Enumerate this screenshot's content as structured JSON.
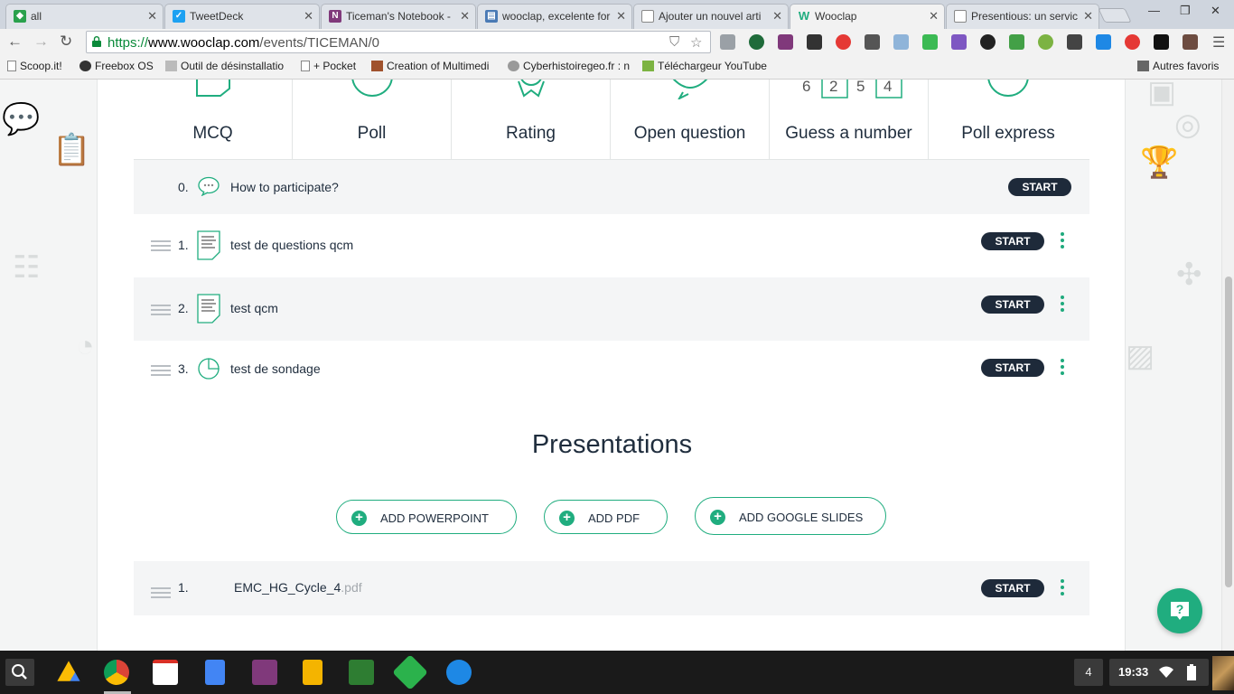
{
  "browser": {
    "tabs": [
      {
        "title": "all",
        "favicon_color": "#2aa14d",
        "close": "✕"
      },
      {
        "title": "TweetDeck",
        "favicon_color": "#1da1f2",
        "close": "✕"
      },
      {
        "title": "Ticeman's Notebook -",
        "favicon_color": "#80397b",
        "close": "✕"
      },
      {
        "title": "wooclap, excelente for",
        "favicon_color": "#4a7ab5",
        "close": "✕"
      },
      {
        "title": "Ajouter un nouvel arti",
        "favicon_color": "#8a8a8a",
        "close": "✕"
      },
      {
        "title": "Wooclap",
        "favicon_color": "#20ad7f",
        "favicon_text": "W",
        "close": "✕",
        "active": true
      },
      {
        "title": "Presentious: un servic",
        "favicon_color": "#8a8a8a",
        "close": "✕"
      }
    ],
    "url": {
      "scheme": "https://",
      "domain": "www.wooclap.com",
      "path": "/events/TICEMAN/0"
    },
    "bookmarks": [
      {
        "label": "Scoop.it!"
      },
      {
        "label": "Freebox OS"
      },
      {
        "label": "Outil de désinstallatio"
      },
      {
        "label": "+ Pocket"
      },
      {
        "label": "Creation of Multimedi"
      },
      {
        "label": "Cyberhistoiregeo.fr : n"
      },
      {
        "label": "Téléchargeur YouTube"
      },
      {
        "label": "Autres favoris"
      }
    ]
  },
  "question_types": [
    {
      "label": "MCQ"
    },
    {
      "label": "Poll"
    },
    {
      "label": "Rating"
    },
    {
      "label": "Open question"
    },
    {
      "label": "Guess a number",
      "digits": [
        "6",
        "2",
        "5",
        "4"
      ]
    },
    {
      "label": "Poll express"
    }
  ],
  "questions": [
    {
      "number": "0.",
      "title": "How to participate?",
      "icon": "speech-bubble-icon",
      "start": "START"
    },
    {
      "number": "1.",
      "title": "test de questions qcm",
      "icon": "document-icon",
      "start": "START"
    },
    {
      "number": "2.",
      "title": "test qcm",
      "icon": "document-icon",
      "start": "START"
    },
    {
      "number": "3.",
      "title": "test de sondage",
      "icon": "pie-chart-icon",
      "start": "START"
    }
  ],
  "presentations": {
    "title": "Presentations",
    "add_buttons": [
      "ADD POWERPOINT",
      "ADD PDF",
      "ADD GOOGLE SLIDES"
    ],
    "items": [
      {
        "number": "1.",
        "name": "EMC_HG_Cycle_4",
        "extension": ".pdf",
        "start": "START"
      }
    ]
  },
  "help_icon": "question-chat-icon",
  "taskbar": {
    "apps": [
      "google-drive-icon",
      "chrome-icon",
      "gmail-icon",
      "docs-icon",
      "onenote-icon",
      "slides-icon",
      "sway-icon",
      "feedly-icon",
      "files-icon"
    ],
    "window_count": "4",
    "time": "19:33"
  }
}
